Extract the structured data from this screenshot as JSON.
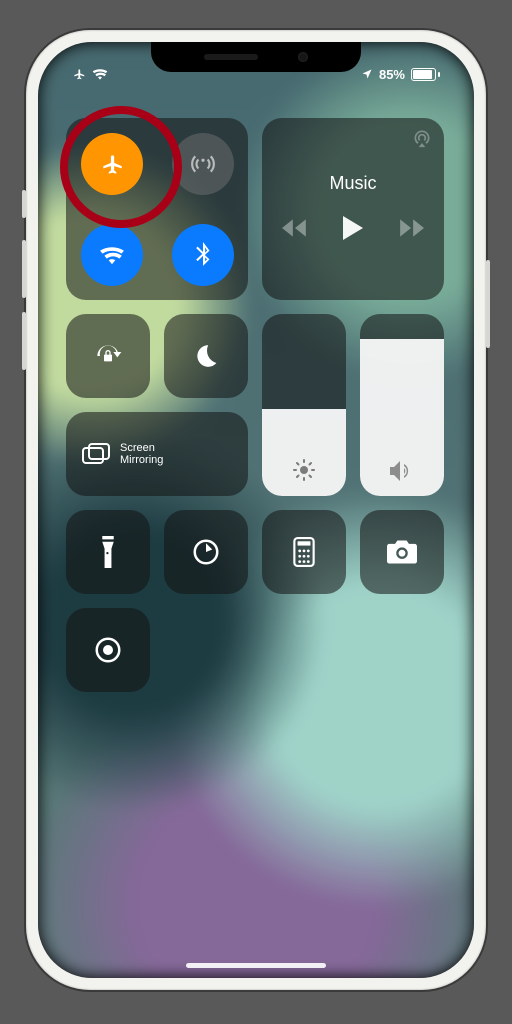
{
  "status": {
    "battery_percent": "85%",
    "airplane_on": true,
    "wifi_on": true,
    "location_on": true
  },
  "connectivity": {
    "airplane": {
      "on": true,
      "color": "#ff9500"
    },
    "cellular_antenna": {
      "on": false
    },
    "wifi": {
      "on": true,
      "color": "#0a7aff"
    },
    "bluetooth": {
      "on": true,
      "color": "#0a7aff"
    }
  },
  "music": {
    "title": "Music",
    "state": "paused"
  },
  "screen_mirroring": {
    "label_line1": "Screen",
    "label_line2": "Mirroring"
  },
  "brightness": {
    "value_percent": 48
  },
  "volume": {
    "value_percent": 86
  },
  "bottom_controls": [
    "flashlight",
    "timer",
    "calculator",
    "camera",
    "screen-record"
  ],
  "annotation": {
    "target": "airplane-mode-toggle"
  }
}
